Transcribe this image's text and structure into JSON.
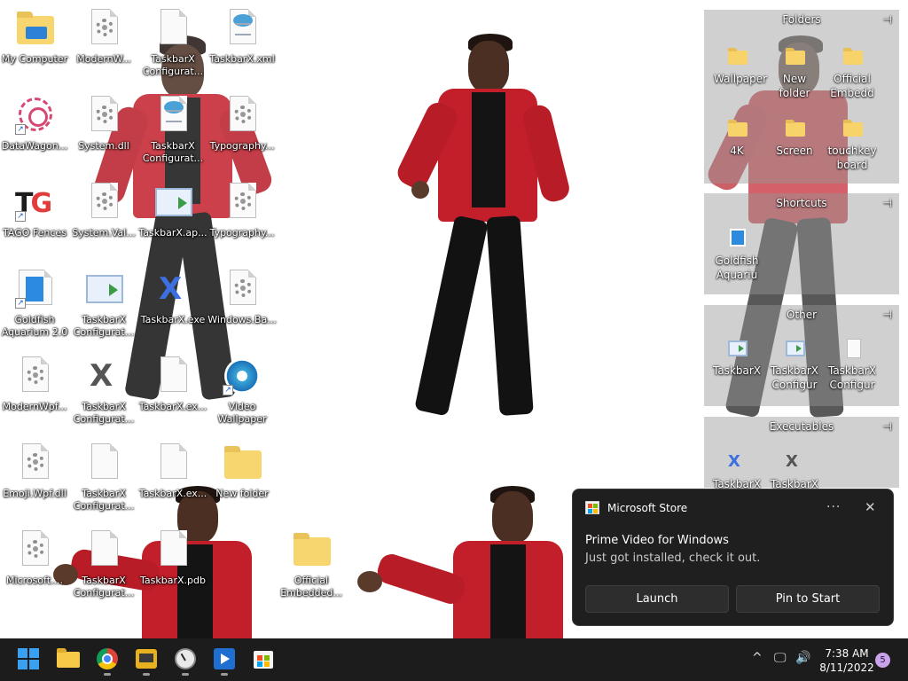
{
  "desktop": {
    "icons": [
      {
        "label": "My Computer"
      },
      {
        "label": "ModernW..."
      },
      {
        "label": "TaskbarX Configurat..."
      },
      {
        "label": "TaskbarX.xml"
      },
      {
        "label": "DataWagon..."
      },
      {
        "label": "System.dll"
      },
      {
        "label": "TaskbarX Configurat..."
      },
      {
        "label": "Typography..."
      },
      {
        "label": "TAGO Fences"
      },
      {
        "label": "System.Val..."
      },
      {
        "label": "TaskbarX.ap..."
      },
      {
        "label": "Typography..."
      },
      {
        "label": "Goldfish Aquarium 2.0"
      },
      {
        "label": "TaskbarX Configurat..."
      },
      {
        "label": "TaskbarX.exe"
      },
      {
        "label": "Windows.Ba..."
      },
      {
        "label": "ModernWpf..."
      },
      {
        "label": "TaskbarX Configurat..."
      },
      {
        "label": "TaskbarX.ex..."
      },
      {
        "label": "Video Wallpaper"
      },
      {
        "label": "Emoji.Wpf.dll"
      },
      {
        "label": "TaskbarX Configurat..."
      },
      {
        "label": "TaskbarX.ex..."
      },
      {
        "label": "New folder"
      },
      {
        "label": "Microsoft...."
      },
      {
        "label": "TaskbarX Configurat..."
      },
      {
        "label": "TaskbarX.pdb"
      },
      {
        "label": "Official Embedded..."
      }
    ]
  },
  "fences": {
    "folders": {
      "title": "Folders",
      "items": [
        {
          "label": "Wallpaper"
        },
        {
          "label": "New folder"
        },
        {
          "label": "Official Embedd"
        },
        {
          "label": "4K"
        },
        {
          "label": "Screen"
        },
        {
          "label": "touchkey board"
        }
      ]
    },
    "shortcuts": {
      "title": "Shortcuts",
      "items": [
        {
          "label": "Goldfish Aquariu"
        }
      ]
    },
    "other": {
      "title": "Other",
      "items": [
        {
          "label": "TaskbarX"
        },
        {
          "label": "TaskbarX Configur"
        },
        {
          "label": "TaskbarX Configur"
        }
      ]
    },
    "executables": {
      "title": "Executables",
      "items": [
        {
          "label": "TaskbarX"
        },
        {
          "label": "TaskbarX"
        }
      ]
    }
  },
  "toast": {
    "app_name": "Microsoft Store",
    "more_label": "···",
    "close_label": "✕",
    "title": "Prime Video for Windows",
    "body": "Just got installed, check it out.",
    "launch_label": "Launch",
    "pin_label": "Pin to Start"
  },
  "taskbar": {
    "apps": [
      "start-icon",
      "file-explorer-icon",
      "chrome-icon",
      "media-app-icon",
      "clock-app-icon",
      "media-player-icon",
      "store-icon"
    ],
    "tray": {
      "chevron": "^",
      "time": "7:38 AM",
      "date": "8/11/2022",
      "notification_count": "5"
    }
  },
  "colors": {
    "accent": "#3aa0f2",
    "toast_bg": "#1f1f1f",
    "taskbar_bg": "#1c1c1c"
  }
}
